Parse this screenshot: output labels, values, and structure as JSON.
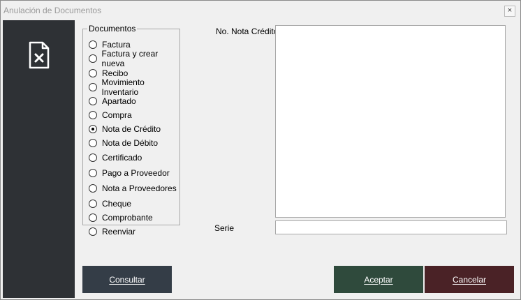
{
  "window": {
    "title": "Anulación de Documentos",
    "close_glyph": "×"
  },
  "sidebar": {
    "icon": "document-cancel-icon"
  },
  "documents": {
    "legend": "Documentos",
    "options": [
      {
        "label": "Factura",
        "checked": false
      },
      {
        "label": "Factura y crear nueva",
        "checked": false
      },
      {
        "label": "Recibo",
        "checked": false
      },
      {
        "label": "Movimiento Inventario",
        "checked": false
      },
      {
        "label": "Apartado",
        "checked": false
      },
      {
        "label": "Compra",
        "checked": false
      },
      {
        "label": "Nota de Crédito",
        "checked": true
      },
      {
        "label": "Nota de Débito",
        "checked": false
      },
      {
        "label": "Certificado",
        "checked": false
      },
      {
        "label": "Pago a Proveedor",
        "checked": false
      },
      {
        "label": "Nota a Proveedores",
        "checked": false
      },
      {
        "label": "Cheque",
        "checked": false
      },
      {
        "label": "Comprobante",
        "checked": false
      },
      {
        "label": "Reenviar",
        "checked": false
      }
    ]
  },
  "form": {
    "number_label": "No. Nota Crédito",
    "number_value": "",
    "serie_label": "Serie",
    "serie_value": ""
  },
  "buttons": {
    "consultar": "Consultar",
    "aceptar": "Aceptar",
    "cancelar": "Cancelar"
  },
  "colors": {
    "sidebar": "#2e3135",
    "consultar": "#343d47",
    "aceptar": "#2f4a3c",
    "cancelar": "#4a2226"
  }
}
